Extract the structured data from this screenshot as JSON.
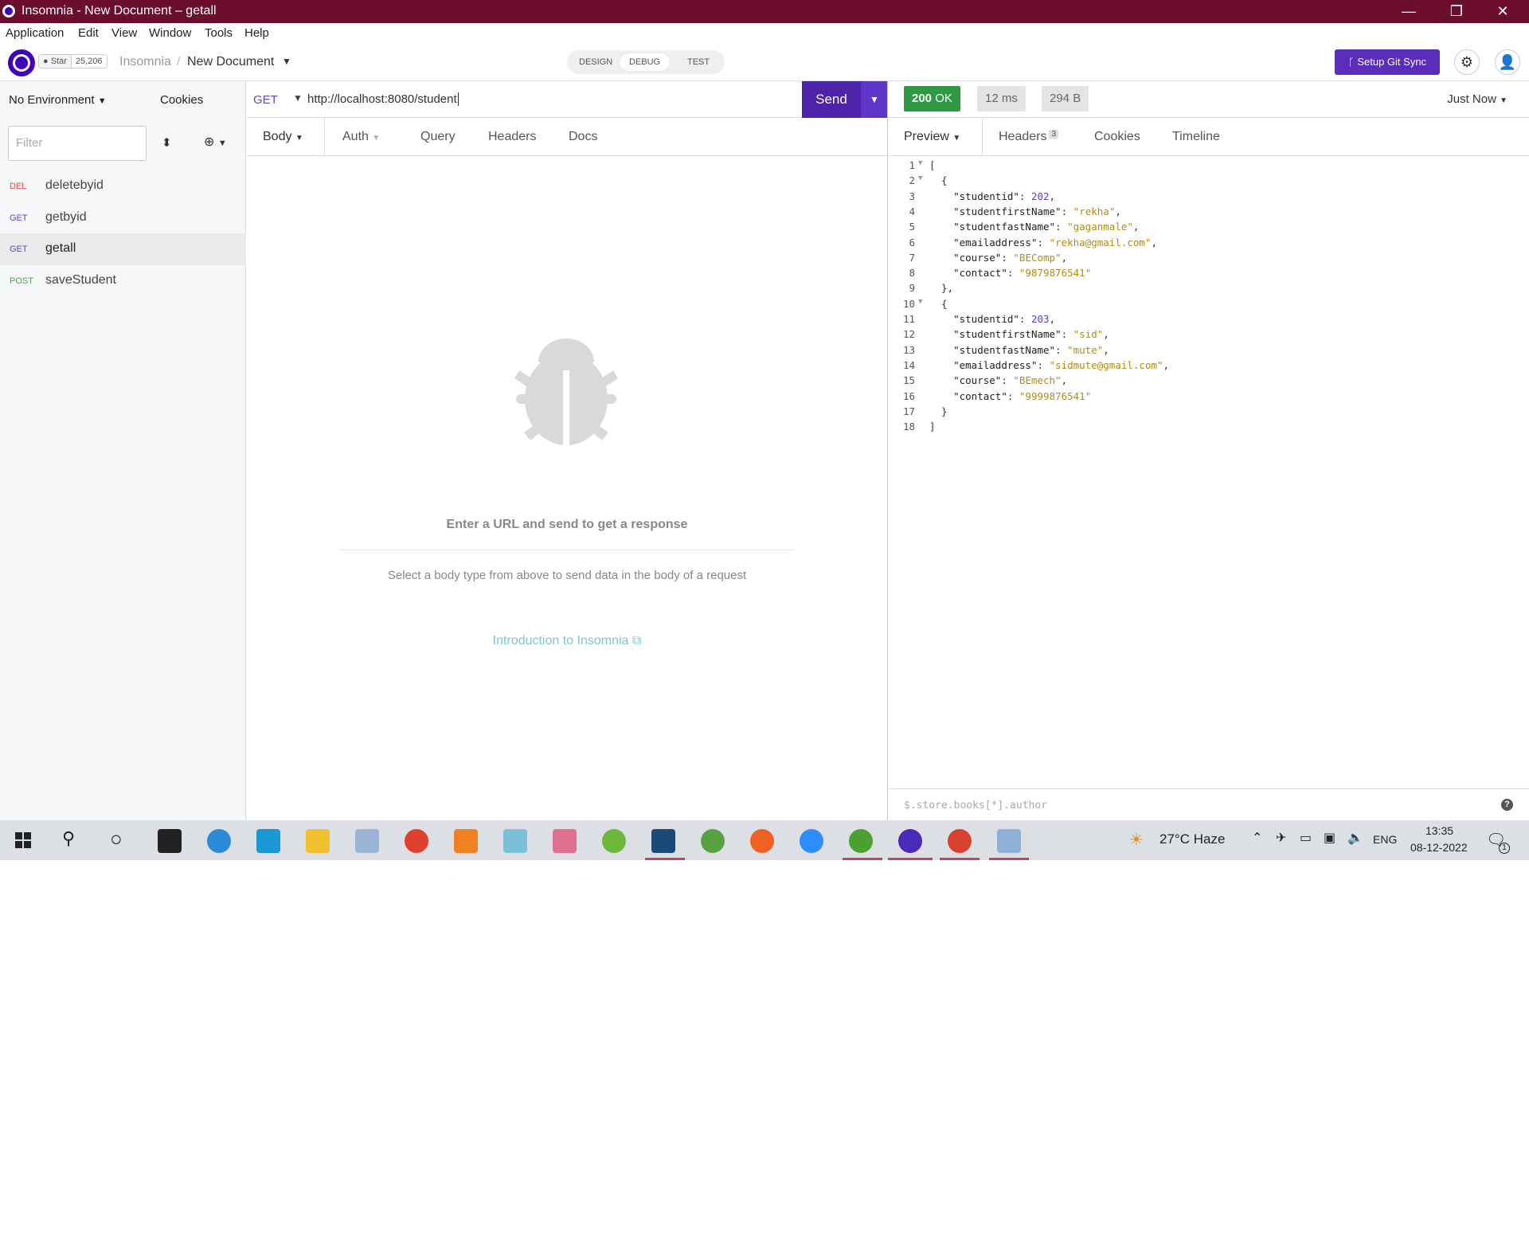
{
  "window": {
    "title": "Insomnia - New Document – getall",
    "controls": [
      "—",
      "❐",
      "✕"
    ]
  },
  "menu": [
    "Application",
    "Edit",
    "View",
    "Window",
    "Tools",
    "Help"
  ],
  "header": {
    "star_label": "Star",
    "star_count": "25,206",
    "breadcrumb_root": "Insomnia",
    "breadcrumb_sep": "/",
    "document": "New Document",
    "modes": [
      "DESIGN",
      "DEBUG",
      "TEST"
    ],
    "active_mode": "DEBUG",
    "git_sync": "Setup Git Sync"
  },
  "sidebar": {
    "environment": "No Environment",
    "cookies": "Cookies",
    "filter_placeholder": "Filter",
    "requests": [
      {
        "method": "DEL",
        "name": "deletebyid",
        "color": "#e5473d"
      },
      {
        "method": "GET",
        "name": "getbyid",
        "color": "#6443c5"
      },
      {
        "method": "GET",
        "name": "getall",
        "color": "#6443c5",
        "active": true
      },
      {
        "method": "POST",
        "name": "saveStudent",
        "color": "#4ea34d"
      }
    ]
  },
  "request": {
    "method": "GET",
    "url": "http://localhost:8080/student",
    "send": "Send",
    "tabs": [
      "Body",
      "Auth",
      "Query",
      "Headers",
      "Docs"
    ],
    "empty_title": "Enter a URL and send to get a response",
    "empty_hint": "Select a body type from above to send data in the body of a request",
    "intro_link": "Introduction to Insomnia"
  },
  "response": {
    "status": "200",
    "status_text": "OK",
    "time": "12 ms",
    "size": "294 B",
    "timestamp": "Just Now",
    "tabs": [
      "Preview",
      "Headers",
      "Cookies",
      "Timeline"
    ],
    "headers_count": "3",
    "filter_placeholder": "$.store.books[*].author",
    "body_lines": [
      "[",
      "  {",
      "    \"studentid\": 202,",
      "    \"studentfirstName\": \"rekha\",",
      "    \"studentfastName\": \"gaganmale\",",
      "    \"emailaddress\": \"rekha@gmail.com\",",
      "    \"course\": \"BEComp\",",
      "    \"contact\": \"9879876541\"",
      "  },",
      "  {",
      "    \"studentid\": 203,",
      "    \"studentfirstName\": \"sid\",",
      "    \"studentfastName\": \"mute\",",
      "    \"emailaddress\": \"sidmute@gmail.com\",",
      "    \"course\": \"BEmech\",",
      "    \"contact\": \"9999876541\"",
      "  }",
      "]"
    ]
  },
  "taskbar": {
    "weather": "27°C  Haze",
    "lang": "ENG",
    "time": "13:35",
    "date": "08-12-2022",
    "notifications": "1"
  },
  "colors": {
    "titlebar": "#6b0d2e",
    "accent": "#4d23a9",
    "ok": "#2e9a44"
  }
}
